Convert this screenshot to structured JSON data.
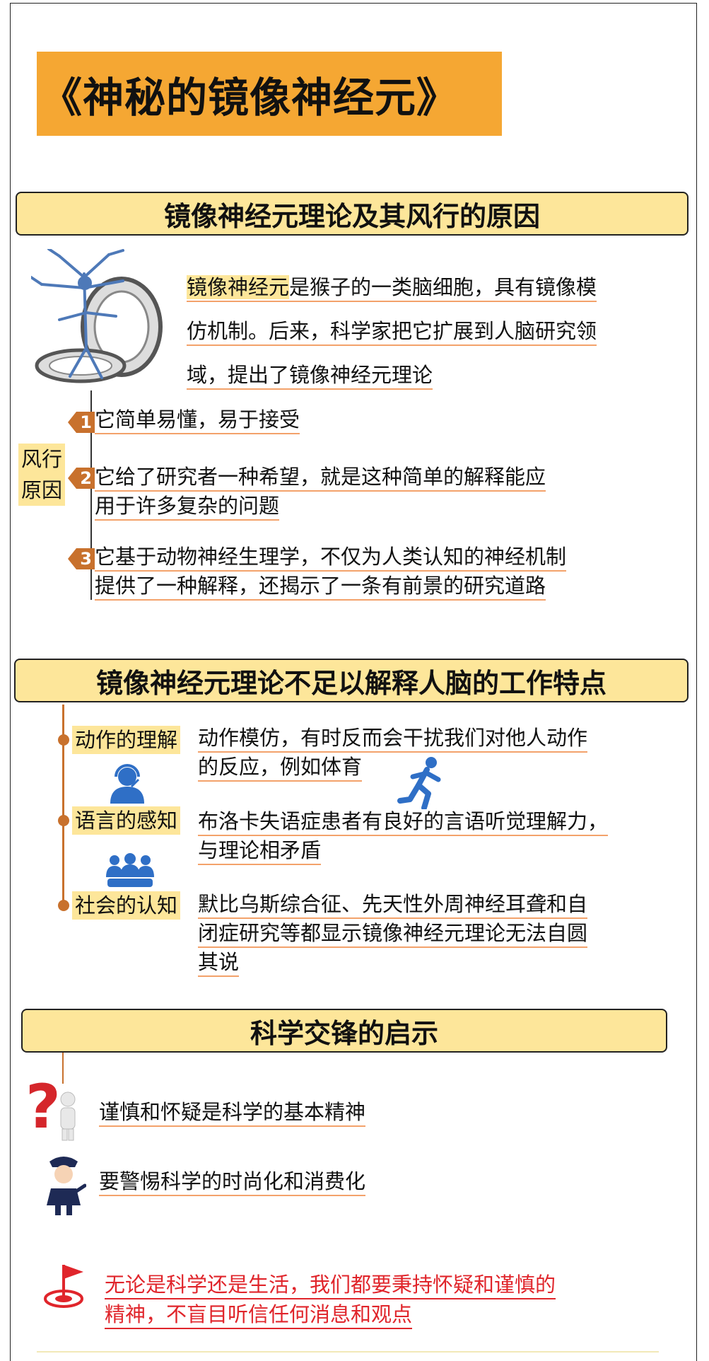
{
  "title": "《神秘的镜像神经元》",
  "section1": {
    "header": "镜像神经元理论及其风行的原因",
    "intro_highlight": "镜像神经元",
    "intro_line1_rest": "是猴子的一类脑细胞，具有镜像模",
    "intro_line2": "仿机制。后来，科学家把它扩展到人脑研究领",
    "intro_line3": "域，提出了镜像神经元理论",
    "side_label_1": "风行",
    "side_label_2": "原因",
    "reasons": [
      {
        "num": "1",
        "lines": [
          "它简单易懂，易于接受"
        ]
      },
      {
        "num": "2",
        "lines": [
          "它给了研究者一种希望，就是这种简单的解释能应",
          "用于许多复杂的问题"
        ]
      },
      {
        "num": "3",
        "lines": [
          "它基于动物神经生理学，不仅为人类认知的神经机制",
          "提供了一种解释，还揭示了一条有前景的研究道路"
        ]
      }
    ]
  },
  "section2": {
    "header": "镜像神经元理论不足以解释人脑的工作特点",
    "items": [
      {
        "label": "动作的理解",
        "lines": [
          "动作模仿，有时反而会干扰我们对他人动作",
          "的反应，例如体育"
        ]
      },
      {
        "label": "语言的感知",
        "lines": [
          "布洛卡失语症患者有良好的言语听觉理解力，",
          "与理论相矛盾"
        ]
      },
      {
        "label": "社会的认知",
        "lines": [
          "默比乌斯综合征、先天性外周神经耳聋和自",
          "闭症研究等都显示镜像神经元理论无法自圆",
          "其说"
        ]
      }
    ]
  },
  "section3": {
    "header": "科学交锋的启示",
    "points": [
      "谨慎和怀疑是科学的基本精神",
      "要警惕科学的时尚化和消费化"
    ],
    "conclusion": [
      "无论是科学还是生活，我们都要秉持怀疑和谨慎的",
      "精神，不盲目听信任何消息和观点"
    ]
  },
  "colors": {
    "banner": "#f5a733",
    "header_bg": "#fde69a",
    "accent": "#c8712d",
    "underline": "#f3a26b",
    "red": "#e0252b",
    "icon_blue": "#2f6fc6"
  }
}
